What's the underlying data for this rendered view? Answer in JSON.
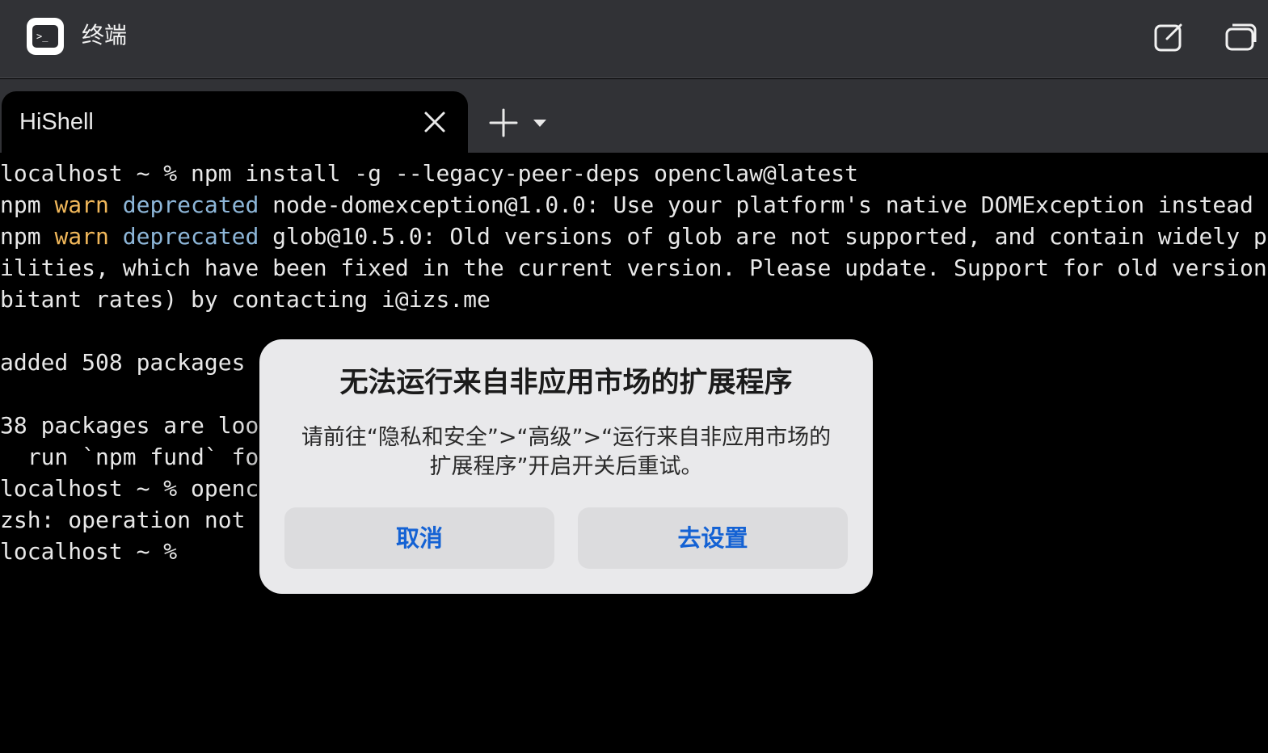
{
  "window": {
    "app_title": "终端",
    "app_icon": "terminal-icon",
    "new_window_icon": "compose-icon",
    "windows_icon": "windows-icon"
  },
  "tabs": [
    {
      "label": "HiShell",
      "close_icon": "close-icon"
    }
  ],
  "tab_actions": {
    "add_icon": "plus-icon",
    "menu_icon": "caret-down-icon"
  },
  "terminal": {
    "lines": [
      "localhost ~ % npm install -g --legacy-peer-deps openclaw@latest",
      [
        "npm ",
        "warn",
        " ",
        "deprecated",
        " node-domexception@1.0.0: Use your platform's native DOMException instead"
      ],
      [
        "npm ",
        "warn",
        " ",
        "deprecated",
        " glob@10.5.0: Old versions of glob are not supported, and contain widely p"
      ],
      "ilities, which have been fixed in the current version. Please update. Support for old version",
      "bitant rates) by contacting i@izs.me",
      "",
      "added 508 packages i",
      "",
      "38 packages are look",
      "  run `npm fund` for",
      "localhost ~ % opencl",
      "zsh: operation not p",
      "localhost ~ %"
    ]
  },
  "dialog": {
    "title": "无法运行来自非应用市场的扩展程序",
    "message": "请前往“隐私和安全”>“高级”>“运行来自非应用市场的扩展程序”开启开关后重试。",
    "cancel_label": "取消",
    "settings_label": "去设置"
  },
  "colors": {
    "warn": "#f0b75a",
    "deprecated": "#8db6d8",
    "dialog_button_text": "#1462d4"
  }
}
